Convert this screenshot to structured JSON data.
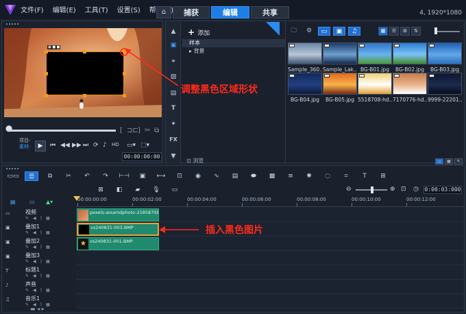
{
  "menubar": {
    "items": [
      "文件(F)",
      "编辑(E)",
      "工具(T)",
      "设置(S)",
      "帮助(H)"
    ]
  },
  "tabs": {
    "home_icon": "home-icon",
    "items": [
      {
        "label": "捕获",
        "active": false
      },
      {
        "label": "编辑",
        "active": true
      },
      {
        "label": "共享",
        "active": false
      }
    ]
  },
  "resolution": "4, 1920*1080",
  "preview": {
    "project_label": "项目-",
    "material_label": "素材-",
    "timecode": "00:00:00:00"
  },
  "library": {
    "add_label": "添加",
    "folders": [
      {
        "label": "样本",
        "selected": true
      },
      {
        "label": "背景",
        "selected": false
      }
    ],
    "browse_label": "浏览",
    "thumbnails": [
      {
        "caption": "Sample_360...",
        "colors": [
          "#6a87a8",
          "#b7c8d7",
          "#3f5470"
        ]
      },
      {
        "caption": "Sample_Lak...",
        "colors": [
          "#1d3d6a",
          "#6fa0cf",
          "#13284b"
        ]
      },
      {
        "caption": "BG-B01.jpg",
        "colors": [
          "#2f74c8",
          "#6ab3ee",
          "#4b9a38"
        ]
      },
      {
        "caption": "BG-B02.jpg",
        "colors": [
          "#2c7fd6",
          "#7cc3f5",
          "#3f8a2b"
        ]
      },
      {
        "caption": "BG-B03.jpg",
        "colors": [
          "#1b5fb8",
          "#64a8e8",
          "#2a6fc0"
        ]
      },
      {
        "caption": "BG-B04.jpg",
        "colors": [
          "#0f2a5c",
          "#243f80",
          "#0a1a3d"
        ]
      },
      {
        "caption": "BG-B05.jpg",
        "colors": [
          "#e06a20",
          "#f8b34a",
          "#7a2c12"
        ]
      },
      {
        "caption": "5518708-hd...",
        "colors": [
          "#f0d070",
          "#ffffff",
          "#e0a030"
        ]
      },
      {
        "caption": "7170776-hd...",
        "colors": [
          "#c77c4d",
          "#e8b48c",
          "#ffffff"
        ]
      },
      {
        "caption": "9999-22201...",
        "colors": [
          "#0e1730",
          "#1c2a4e",
          "#070d1e"
        ]
      }
    ]
  },
  "timeline": {
    "timecode": "0:00:03:000",
    "ruler_ticks": [
      "00:00:00:00",
      "00:00:02:00",
      "00:00:04:00",
      "00:00:06:00",
      "00:00:08:00",
      "00:00:10:00",
      "00:00:12:00"
    ],
    "tracks": [
      {
        "name": "视频",
        "clip": "pexels-aixamdphoto-21858708.jpg"
      },
      {
        "name": "叠加1",
        "clip": "vs240831-003.BMP"
      },
      {
        "name": "叠加2",
        "clip": "vs240831-001.BMP"
      },
      {
        "name": "叠加3",
        "clip": ""
      },
      {
        "name": "标题1",
        "clip": ""
      },
      {
        "name": "声音",
        "clip": ""
      },
      {
        "name": "音乐1",
        "clip": ""
      }
    ]
  },
  "annotations": {
    "adjust_shape": "调整黑色区域形状",
    "insert_black": "插入黑色图片",
    "color": "#ff2a1a"
  },
  "colors": {
    "accent": "#1d7ee6",
    "clip": "#1f8a6d",
    "handle": "#f29a1d"
  }
}
